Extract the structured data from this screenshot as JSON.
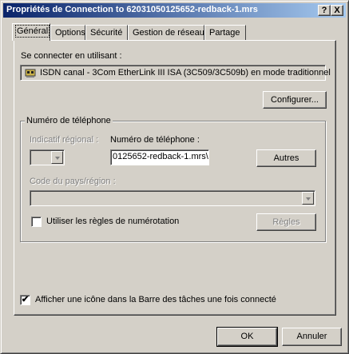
{
  "window": {
    "title": "Propriétés de Connection to 62031050125652-redback-1.mrs",
    "help_button": "?",
    "close_button": "X"
  },
  "tabs": [
    {
      "label": "Général",
      "active": true
    },
    {
      "label": "Options"
    },
    {
      "label": "Sécurité"
    },
    {
      "label": "Gestion de réseau"
    },
    {
      "label": "Partage"
    }
  ],
  "general": {
    "connect_using_label": "Se connecter en utilisant :",
    "device": "ISDN  canal - 3Com EtherLink III ISA (3C509/3C509b) en mode traditionnel",
    "configure_button": "Configurer...",
    "phone_group": {
      "title": "Numéro de téléphone",
      "area_code_label": "Indicatif régional :",
      "area_code_value": "",
      "phone_label": "Numéro de téléphone :",
      "phone_value": "0125652-redback-1.mrs\\",
      "others_button": "Autres",
      "country_label": "Code du pays/région :",
      "country_value": "",
      "use_rules_label": "Utiliser les règles de numérotation",
      "use_rules_checked": false,
      "rules_button": "Règles"
    },
    "show_icon_label": "Afficher une icône dans la Barre des tâches une fois connecté",
    "show_icon_checked": "✔"
  },
  "footer": {
    "ok_button": "OK",
    "cancel_button": "Annuler"
  }
}
